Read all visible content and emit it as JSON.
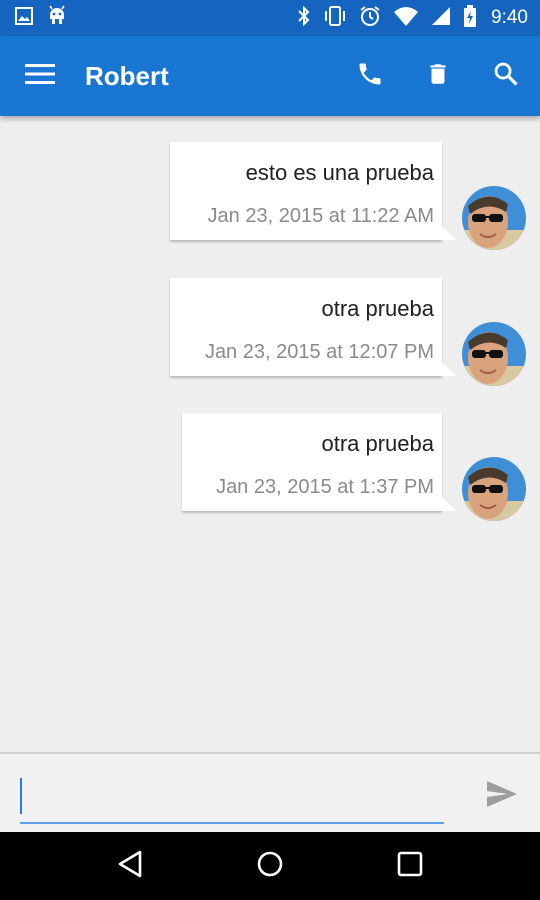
{
  "status_bar": {
    "time": "9:40",
    "left_icons": [
      "image-notification-icon",
      "android-debug-icon"
    ],
    "right_icons": [
      "bluetooth-icon",
      "vibrate-icon",
      "alarm-icon",
      "wifi-icon",
      "cell-signal-icon",
      "battery-icon"
    ]
  },
  "app_bar": {
    "title": "Robert",
    "nav_icon": "menu-icon",
    "actions": [
      "phone-icon",
      "delete-icon",
      "search-icon"
    ]
  },
  "messages": [
    {
      "text": "esto es una prueba",
      "time": "Jan 23, 2015 at 11:22 AM"
    },
    {
      "text": "otra prueba",
      "time": "Jan 23, 2015 at 12:07 PM"
    },
    {
      "text": "otra prueba",
      "time": "Jan 23, 2015 at 1:37 PM"
    }
  ],
  "composer": {
    "value": "",
    "placeholder": "",
    "send_icon": "send-icon"
  },
  "nav_bar": {
    "icons": [
      "back-icon",
      "home-icon",
      "recents-icon"
    ]
  },
  "colors": {
    "status_bar": "#1565c0",
    "app_bar": "#1976d2",
    "background": "#eeeeee",
    "accent": "#2979ff"
  }
}
